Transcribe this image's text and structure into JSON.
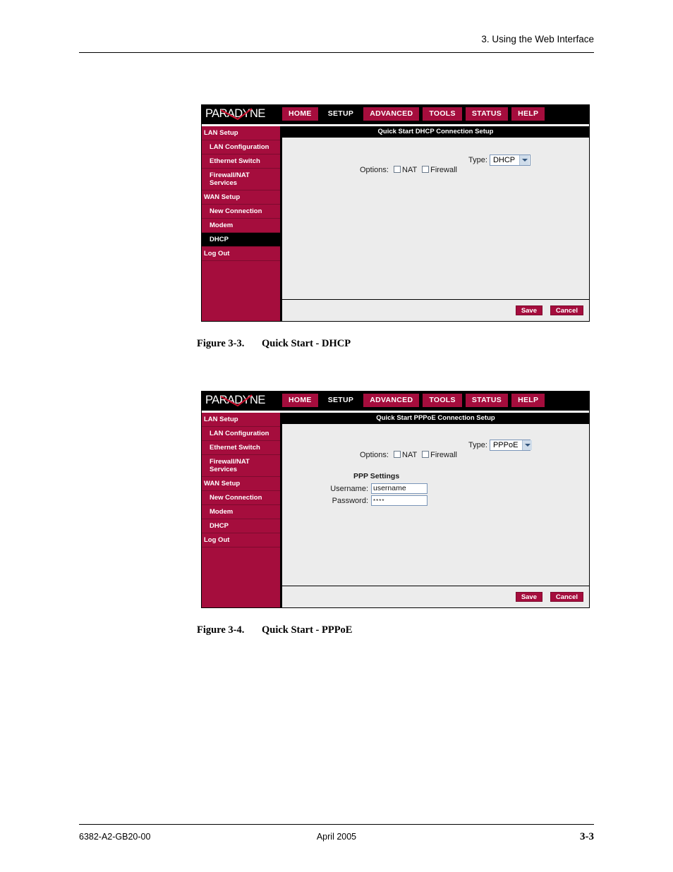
{
  "page": {
    "header_title": "3. Using the Web Interface",
    "footer_left": "6382-A2-GB20-00",
    "footer_center": "April 2005",
    "footer_right": "3-3"
  },
  "figures": [
    {
      "caption_number": "Figure 3-3.",
      "caption_title": "Quick Start - DHCP",
      "ui": {
        "logo": "PARADYNE",
        "nav": [
          {
            "label": "HOME",
            "active": false
          },
          {
            "label": "SETUP",
            "active": true
          },
          {
            "label": "ADVANCED",
            "active": false
          },
          {
            "label": "TOOLS",
            "active": false
          },
          {
            "label": "STATUS",
            "active": false
          },
          {
            "label": "HELP",
            "active": false
          }
        ],
        "sidebar": [
          {
            "label": "LAN Setup",
            "sub": false,
            "selected": false
          },
          {
            "label": "LAN Configuration",
            "sub": true,
            "selected": false
          },
          {
            "label": "Ethernet Switch",
            "sub": true,
            "selected": false
          },
          {
            "label": "Firewall/NAT\nServices",
            "sub": true,
            "selected": false
          },
          {
            "label": "WAN Setup",
            "sub": false,
            "selected": false
          },
          {
            "label": "New Connection",
            "sub": true,
            "selected": false
          },
          {
            "label": "Modem",
            "sub": true,
            "selected": false
          },
          {
            "label": "DHCP",
            "sub": true,
            "selected": true
          },
          {
            "label": "Log Out",
            "sub": false,
            "selected": false
          }
        ],
        "content_title": "Quick Start DHCP Connection Setup",
        "type_label": "Type:",
        "type_value": "DHCP",
        "options_label": "Options:",
        "option_nat": "NAT",
        "option_firewall": "Firewall",
        "option_nat_checked": false,
        "option_firewall_checked": false,
        "ppp": null,
        "save_label": "Save",
        "cancel_label": "Cancel"
      }
    },
    {
      "caption_number": "Figure 3-4.",
      "caption_title": "Quick Start - PPPoE",
      "ui": {
        "logo": "PARADYNE",
        "nav": [
          {
            "label": "HOME",
            "active": false
          },
          {
            "label": "SETUP",
            "active": true
          },
          {
            "label": "ADVANCED",
            "active": false
          },
          {
            "label": "TOOLS",
            "active": false
          },
          {
            "label": "STATUS",
            "active": false
          },
          {
            "label": "HELP",
            "active": false
          }
        ],
        "sidebar": [
          {
            "label": "LAN Setup",
            "sub": false,
            "selected": false
          },
          {
            "label": "LAN Configuration",
            "sub": true,
            "selected": false
          },
          {
            "label": "Ethernet Switch",
            "sub": true,
            "selected": false
          },
          {
            "label": "Firewall/NAT\nServices",
            "sub": true,
            "selected": false
          },
          {
            "label": "WAN Setup",
            "sub": false,
            "selected": false
          },
          {
            "label": "New Connection",
            "sub": true,
            "selected": false
          },
          {
            "label": "Modem",
            "sub": true,
            "selected": false
          },
          {
            "label": "DHCP",
            "sub": true,
            "selected": false
          },
          {
            "label": "Log Out",
            "sub": false,
            "selected": false
          }
        ],
        "content_title": "Quick Start PPPoE Connection Setup",
        "type_label": "Type:",
        "type_value": "PPPoE",
        "options_label": "Options:",
        "option_nat": "NAT",
        "option_firewall": "Firewall",
        "option_nat_checked": false,
        "option_firewall_checked": false,
        "ppp": {
          "section_title": "PPP Settings",
          "username_label": "Username:",
          "username_value": "username",
          "password_label": "Password:",
          "password_value": "****"
        },
        "save_label": "Save",
        "cancel_label": "Cancel"
      }
    }
  ]
}
